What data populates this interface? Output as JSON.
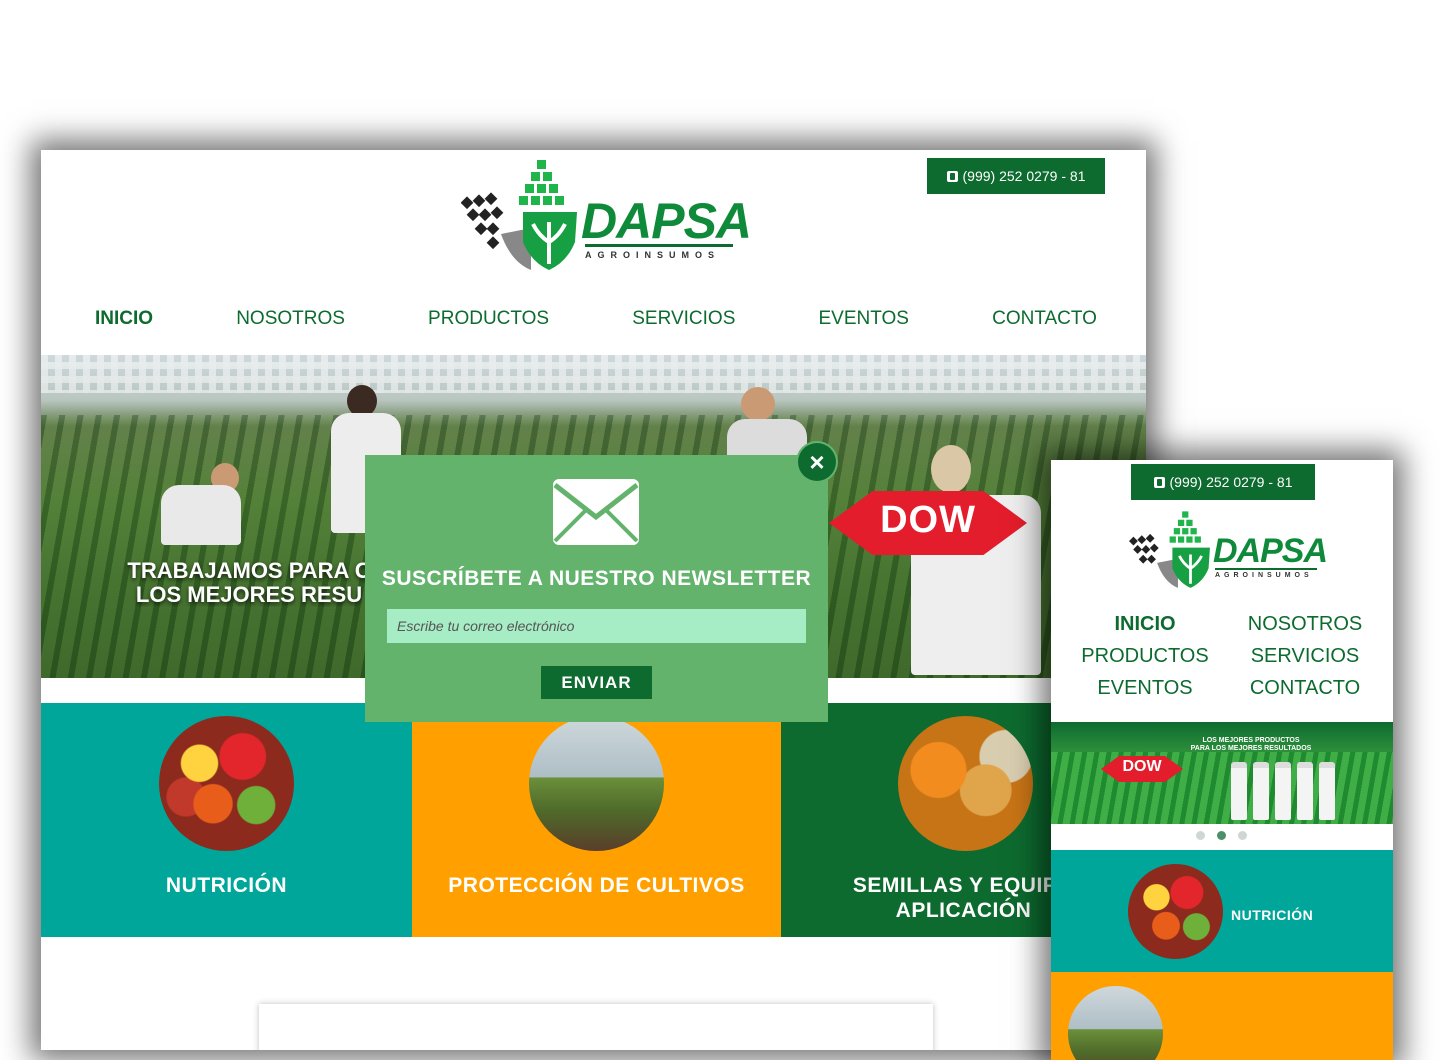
{
  "brand": {
    "name": "DAPSA",
    "tagline": "AGROINSUMOS",
    "colors": {
      "primary_green": "#0d6b2f",
      "logo_green": "#0e8a3a",
      "teal": "#00a69a",
      "orange": "#ffa000",
      "popup_green": "#63b36d",
      "input_mint": "#a6ecc4"
    }
  },
  "contact": {
    "phone": "(999) 252 0279 - 81",
    "icon": "phone-icon"
  },
  "desktop": {
    "nav": [
      "INICIO",
      "NOSOTROS",
      "PRODUCTOS",
      "SERVICIOS",
      "EVENTOS",
      "CONTACTO"
    ],
    "active_nav": "INICIO",
    "hero": {
      "title_line1": "TRABAJAMOS PARA C",
      "title_line2": "LOS MEJORES RESU",
      "partner": "DOW"
    },
    "categories": [
      {
        "label": "NUTRICIÓN",
        "color": "#00a69a"
      },
      {
        "label": "PROTECCIÓN DE CULTIVOS",
        "color": "#ffa000"
      },
      {
        "label_line1": "SEMILLAS Y EQUIPO",
        "label_line2": "APLICACIÓN",
        "color": "#0d6b2f"
      }
    ]
  },
  "popup": {
    "close_icon": "close-icon",
    "mail_icon": "envelope-icon",
    "title": "SUSCRÍBETE A NUESTRO NEWSLETTER",
    "email_placeholder": "Escribe tu correo electrónico",
    "email_value": "",
    "button": "ENVIAR"
  },
  "mobile": {
    "nav": [
      "INICIO",
      "NOSOTROS",
      "PRODUCTOS",
      "SERVICIOS",
      "EVENTOS",
      "CONTACTO"
    ],
    "banner": {
      "line1": "LOS MEJORES PRODUCTOS",
      "line2": "PARA LOS MEJORES RESULTADOS",
      "partner": "DOW"
    },
    "carousel": {
      "slides": 3,
      "active": 2
    },
    "categories": [
      {
        "label": "NUTRICIÓN"
      }
    ]
  }
}
